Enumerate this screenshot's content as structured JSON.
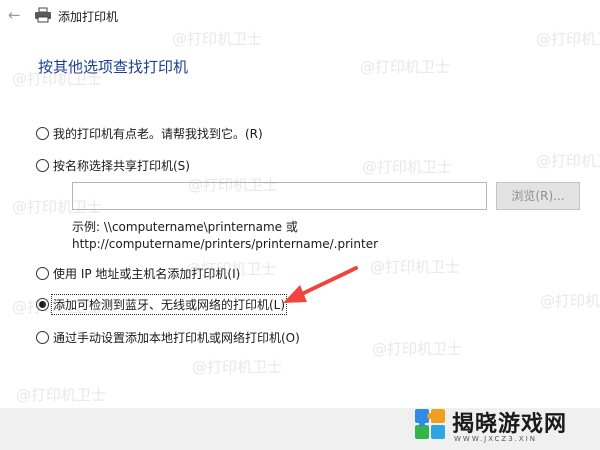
{
  "window": {
    "back_icon": "back-arrow-icon",
    "icon": "printer-icon",
    "title": "添加打印机"
  },
  "heading": "按其他选项查找打印机",
  "options": [
    {
      "label": "我的打印机有点老。请帮我找到它。(R)",
      "selected": false
    },
    {
      "label": "按名称选择共享打印机(S)",
      "selected": false
    },
    {
      "label": "使用 IP 地址或主机名添加打印机(I)",
      "selected": false
    },
    {
      "label": "添加可检测到蓝牙、无线或网络的打印机(L)",
      "selected": true
    },
    {
      "label": "通过手动设置添加本地打印机或网络打印机(O)",
      "selected": false
    }
  ],
  "shared_printer": {
    "value": "",
    "browse_label": "浏览(R)...",
    "example_line1": "示例: \\\\computername\\printername 或",
    "example_line2": "http://computername/printers/printername/.printer"
  },
  "annotation": {
    "color": "#f0443c"
  },
  "watermark": "@打印机卫士",
  "site_logo": {
    "text": "揭晓游戏网",
    "url": "WWW.JXCZ3.XIN"
  }
}
